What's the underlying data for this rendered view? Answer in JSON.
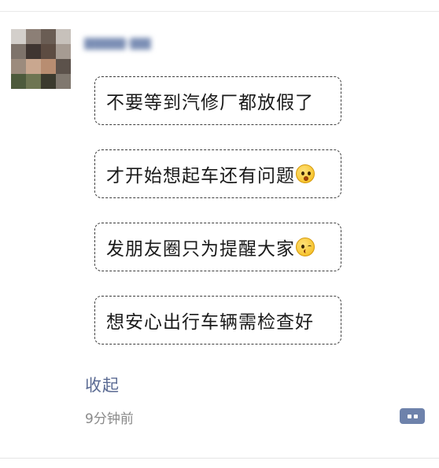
{
  "post": {
    "author_name": "▆▆▆▆-▆▆",
    "lines": [
      {
        "text": "不要等到汽修厂都放假了",
        "emoji": ""
      },
      {
        "text": "才开始想起车还有问题",
        "emoji": "surprised-face-icon"
      },
      {
        "text": "发朋友圈只为提醒大家",
        "emoji": "kissing-face-icon"
      },
      {
        "text": "想安心出行车辆需检查好",
        "emoji": ""
      }
    ],
    "collapse_label": "收起",
    "timestamp": "9分钟前"
  },
  "colors": {
    "link": "#5b6b93",
    "comment_button": "#6e82ab",
    "timestamp": "#8a8a8a"
  }
}
